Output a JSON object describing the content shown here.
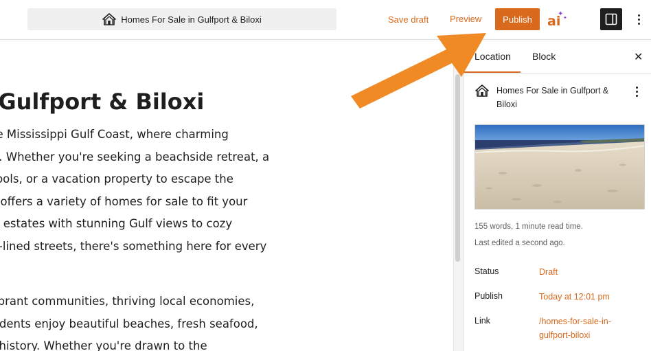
{
  "header": {
    "doc_title": "Homes For Sale in Gulfport & Biloxi",
    "save_draft_label": "Save draft",
    "preview_label": "Preview",
    "publish_label": "Publish",
    "ai_label": "ai",
    "more_options_icon": "vertical-ellipsis-icon",
    "sidebar_toggle_icon": "sidebar-panel-icon"
  },
  "editor": {
    "title": "Sale in Gulfport & Biloxi",
    "paragraph1": [
      "ort-Biloxi area of the Mississippi Gulf Coast, where charming",
      "southern hospitality. Whether you're seeking a beachside retreat, a",
      "y access to top schools, or a vacation property to escape the",
      " Gulfport-Biloxi area offers a variety of homes for sale to fit your",
      " spacious waterfront estates with stunning Gulf views to cozy",
      "ng picturesque tree-lined streets, there's something here for every"
    ],
    "paragraph2": [
      "e known for their vibrant communities, thriving local economies,",
      "lass amenities. Residents enjoy beautiful beaches, fresh seafood,",
      "ctivities, and a rich history. Whether you're drawn to the"
    ]
  },
  "sidebar": {
    "tabs": [
      {
        "label": "Location"
      },
      {
        "label": "Block"
      }
    ],
    "close_icon": "close-icon",
    "location_title": "Homes For Sale in Gulfport & Biloxi",
    "word_count": "155 words, 1 minute read time.",
    "last_edited": "Last edited a second ago.",
    "rows": {
      "status": {
        "label": "Status",
        "value": "Draft"
      },
      "publish": {
        "label": "Publish",
        "value": "Today at 12:01 pm"
      },
      "link": {
        "label": "Link",
        "value": "/homes-for-sale-in-gulfport-biloxi"
      }
    }
  },
  "colors": {
    "accent": "#d9691c",
    "arrow": "#f08a24",
    "toggle_bg": "#1e1e1e"
  }
}
